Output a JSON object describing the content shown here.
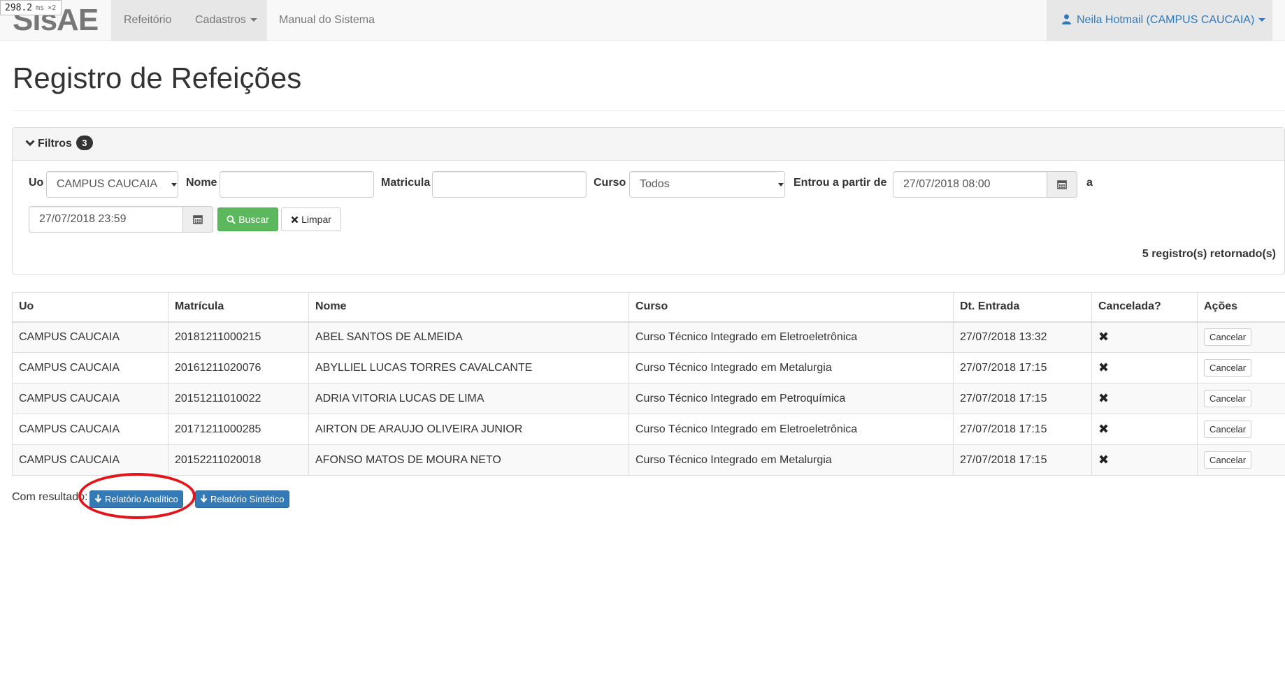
{
  "debug": {
    "value": "298.2",
    "unit": "ms",
    "multiplier": "×2"
  },
  "navbar": {
    "brand": "SisAE",
    "items": [
      {
        "label": "Refeitório"
      },
      {
        "label": "Cadastros"
      },
      {
        "label": "Manual do Sistema"
      }
    ],
    "user": "Neila Hotmail (CAMPUS CAUCAIA)"
  },
  "page": {
    "title": "Registro de Refeições"
  },
  "filters": {
    "title": "Filtros",
    "count": "3",
    "uo_label": "Uo",
    "uo_value": "CAMPUS CAUCAIA",
    "nome_label": "Nome",
    "nome_value": "",
    "matricula_label": "Matricula",
    "matricula_value": "",
    "curso_label": "Curso",
    "curso_value": "Todos",
    "entrou_label": "Entrou a partir de",
    "start_date": "27/07/2018 08:00",
    "a_label": "a",
    "end_date": "27/07/2018 23:59",
    "buscar_label": "Buscar",
    "limpar_label": "Limpar",
    "result_count": "5 registro(s) retornado(s)"
  },
  "table": {
    "columns": [
      "Uo",
      "Matrícula",
      "Nome",
      "Curso",
      "Dt. Entrada",
      "Cancelada?",
      "Ações"
    ],
    "action_label": "Cancelar",
    "rows": [
      {
        "uo": "CAMPUS CAUCAIA",
        "matricula": "20181211000215",
        "nome": "ABEL SANTOS DE ALMEIDA",
        "curso": "Curso Técnico Integrado em Eletroeletrônica",
        "dt_entrada": "27/07/2018 13:32"
      },
      {
        "uo": "CAMPUS CAUCAIA",
        "matricula": "20161211020076",
        "nome": "ABYLLIEL LUCAS TORRES CAVALCANTE",
        "curso": "Curso Técnico Integrado em Metalurgia",
        "dt_entrada": "27/07/2018 17:15"
      },
      {
        "uo": "CAMPUS CAUCAIA",
        "matricula": "20151211010022",
        "nome": "ADRIA VITORIA LUCAS DE LIMA",
        "curso": "Curso Técnico Integrado em Petroquímica",
        "dt_entrada": "27/07/2018 17:15"
      },
      {
        "uo": "CAMPUS CAUCAIA",
        "matricula": "20171211000285",
        "nome": "AIRTON DE ARAUJO OLIVEIRA JUNIOR",
        "curso": "Curso Técnico Integrado em Eletroeletrônica",
        "dt_entrada": "27/07/2018 17:15"
      },
      {
        "uo": "CAMPUS CAUCAIA",
        "matricula": "20152211020018",
        "nome": "AFONSO MATOS DE MOURA NETO",
        "curso": "Curso Técnico Integrado em Metalurgia",
        "dt_entrada": "27/07/2018 17:15"
      }
    ]
  },
  "results": {
    "label": "Com resultado:",
    "analitico": "Relatório Analítico",
    "sintetico": "Relatório Sintético"
  },
  "icons": {
    "cancelled": "x-mark-icon",
    "calendar": "calendar-icon",
    "download": "arrow-down-icon"
  },
  "colors": {
    "primary": "#337ab7",
    "success": "#5cb85c",
    "highlight": "#e3141a"
  }
}
